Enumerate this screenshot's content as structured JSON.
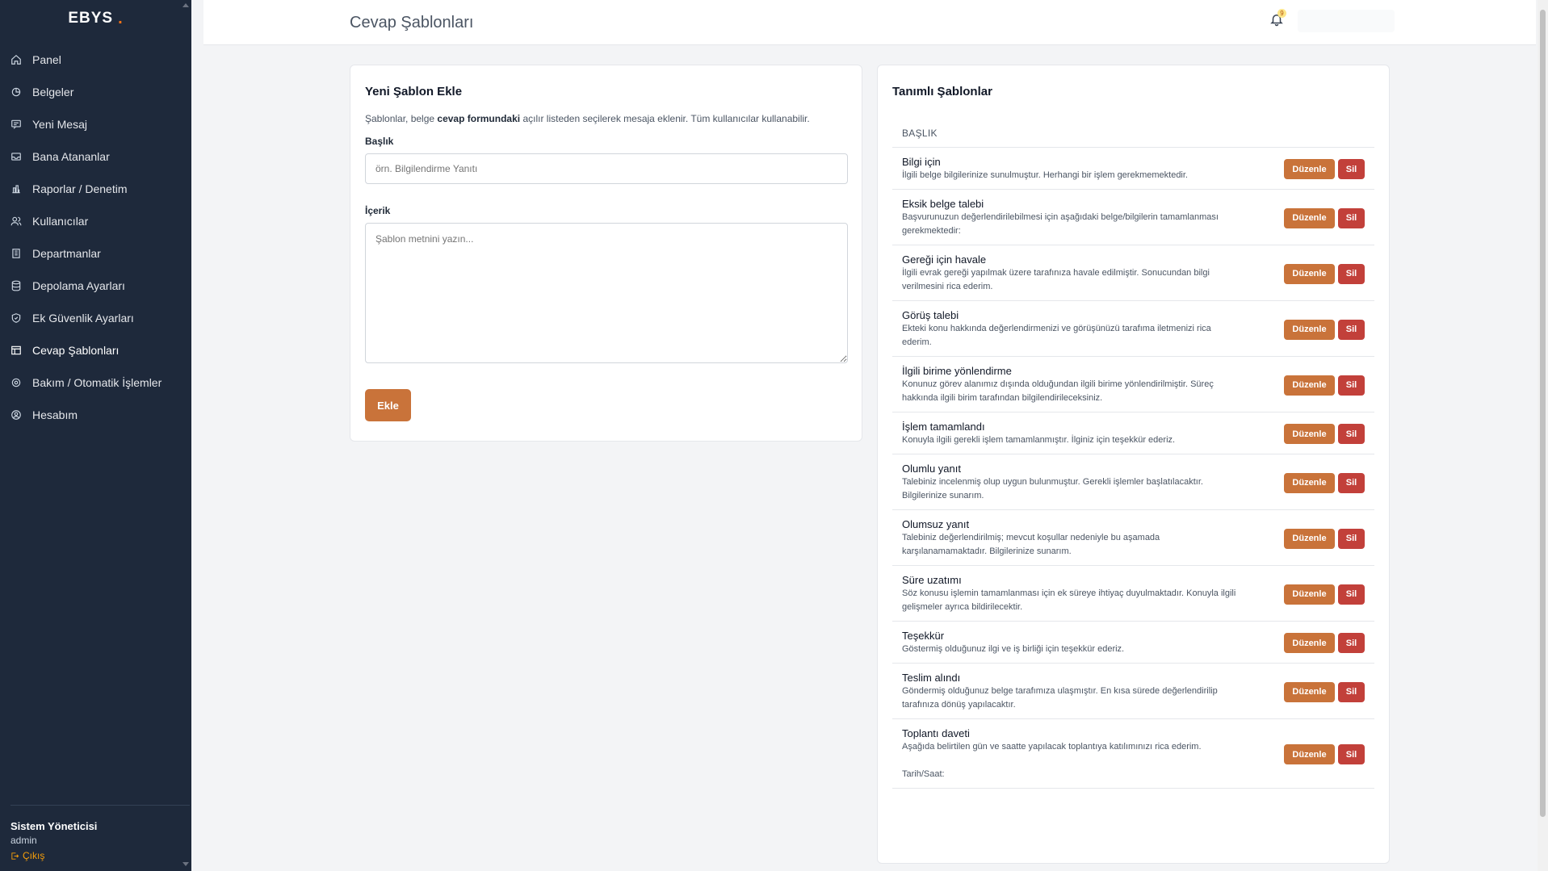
{
  "brand": {
    "name": "EBYS",
    "dot": "."
  },
  "sidebar": {
    "items": [
      {
        "label": "Panel",
        "icon": "home-icon"
      },
      {
        "label": "Belgeler",
        "icon": "documents-icon"
      },
      {
        "label": "Yeni Mesaj",
        "icon": "message-icon"
      },
      {
        "label": "Bana Atananlar",
        "icon": "inbox-icon"
      },
      {
        "label": "Raporlar / Denetim",
        "icon": "chart-icon"
      },
      {
        "label": "Kullanıcılar",
        "icon": "users-icon"
      },
      {
        "label": "Departmanlar",
        "icon": "building-icon"
      },
      {
        "label": "Depolama Ayarları",
        "icon": "database-icon"
      },
      {
        "label": "Ek Güvenlik Ayarları",
        "icon": "shield-icon"
      },
      {
        "label": "Cevap Şablonları",
        "icon": "template-icon"
      },
      {
        "label": "Bakım / Otomatik İşlemler",
        "icon": "gear-icon"
      },
      {
        "label": "Hesabım",
        "icon": "user-circle-icon"
      }
    ],
    "active_index": 9,
    "footer": {
      "user_name": "Sistem Yöneticisi",
      "role": "admin",
      "logout": "Çıkış"
    }
  },
  "header": {
    "title": "Cevap Şablonları",
    "notification_count": "9"
  },
  "add_form": {
    "title": "Yeni Şablon Ekle",
    "desc_prefix": "Şablonlar, belge ",
    "desc_bold": "cevap formundaki",
    "desc_suffix": " açılır listeden seçilerek mesaja eklenir. Tüm kullanıcılar kullanabilir.",
    "title_label": "Başlık",
    "title_placeholder": "örn. Bilgilendirme Yanıtı",
    "content_label": "İçerik",
    "content_placeholder": "Şablon metnini yazın...",
    "submit_label": "Ekle"
  },
  "list": {
    "title": "Tanımlı Şablonlar",
    "column_header": "BAŞLIK",
    "edit_label": "Düzenle",
    "delete_label": "Sil",
    "rows": [
      {
        "title": "Bilgi için",
        "body": "İlgili belge bilgilerinize sunulmuştur. Herhangi bir işlem gerekmemektedir."
      },
      {
        "title": "Eksik belge talebi",
        "body": "Başvurunuzun değerlendirilebilmesi için aşağıdaki belge/bilgilerin tamamlanması\ngerekmektedir:\n "
      },
      {
        "title": "Gereği için havale",
        "body": "İlgili evrak gereği yapılmak üzere tarafınıza havale edilmiştir. Sonucundan bilgi\nverilmesini rica ederim."
      },
      {
        "title": "Görüş talebi",
        "body": "Ekteki konu hakkında değerlendirmenizi ve görüşünüzü tarafıma iletmenizi rica\nederim."
      },
      {
        "title": "İlgili birime yönlendirme",
        "body": "Konunuz görev alanımız dışında olduğundan ilgili birime yönlendirilmiştir. Süreç\nhakkında ilgili birim tarafından bilgilendirileceksiniz."
      },
      {
        "title": "İşlem tamamlandı",
        "body": "Konuyla ilgili gerekli işlem tamamlanmıştır. İlginiz için teşekkür ederiz."
      },
      {
        "title": "Olumlu yanıt",
        "body": "Talebiniz incelenmiş olup uygun bulunmuştur. Gerekli işlemler başlatılacaktır.\nBilgilerinize sunarım."
      },
      {
        "title": "Olumsuz yanıt",
        "body": "Talebiniz değerlendirilmiş; mevcut koşullar nedeniyle bu aşamada\nkarşılanamamaktadır. Bilgilerinize sunarım."
      },
      {
        "title": "Süre uzatımı",
        "body": "Söz konusu işlemin tamamlanması için ek süreye ihtiyaç duyulmaktadır. Konuyla ilgili\ngelişmeler ayrıca bildirilecektir."
      },
      {
        "title": "Teşekkür",
        "body": "Göstermiş olduğunuz ilgi ve iş birliği için teşekkür ederiz."
      },
      {
        "title": "Teslim alındı",
        "body": "Göndermiş olduğunuz belge tarafımıza ulaşmıştır. En kısa sürede değerlendirilip\ntarafınıza dönüş yapılacaktır."
      },
      {
        "title": "Toplantı daveti",
        "body": "Aşağıda belirtilen gün ve saatte yapılacak toplantıya katılımınızı rica ederim.\n\nTarih/Saat:"
      }
    ]
  },
  "colors": {
    "sidebar_bg": "#1e293b",
    "accent": "#c9733a",
    "danger": "#c2403a"
  }
}
